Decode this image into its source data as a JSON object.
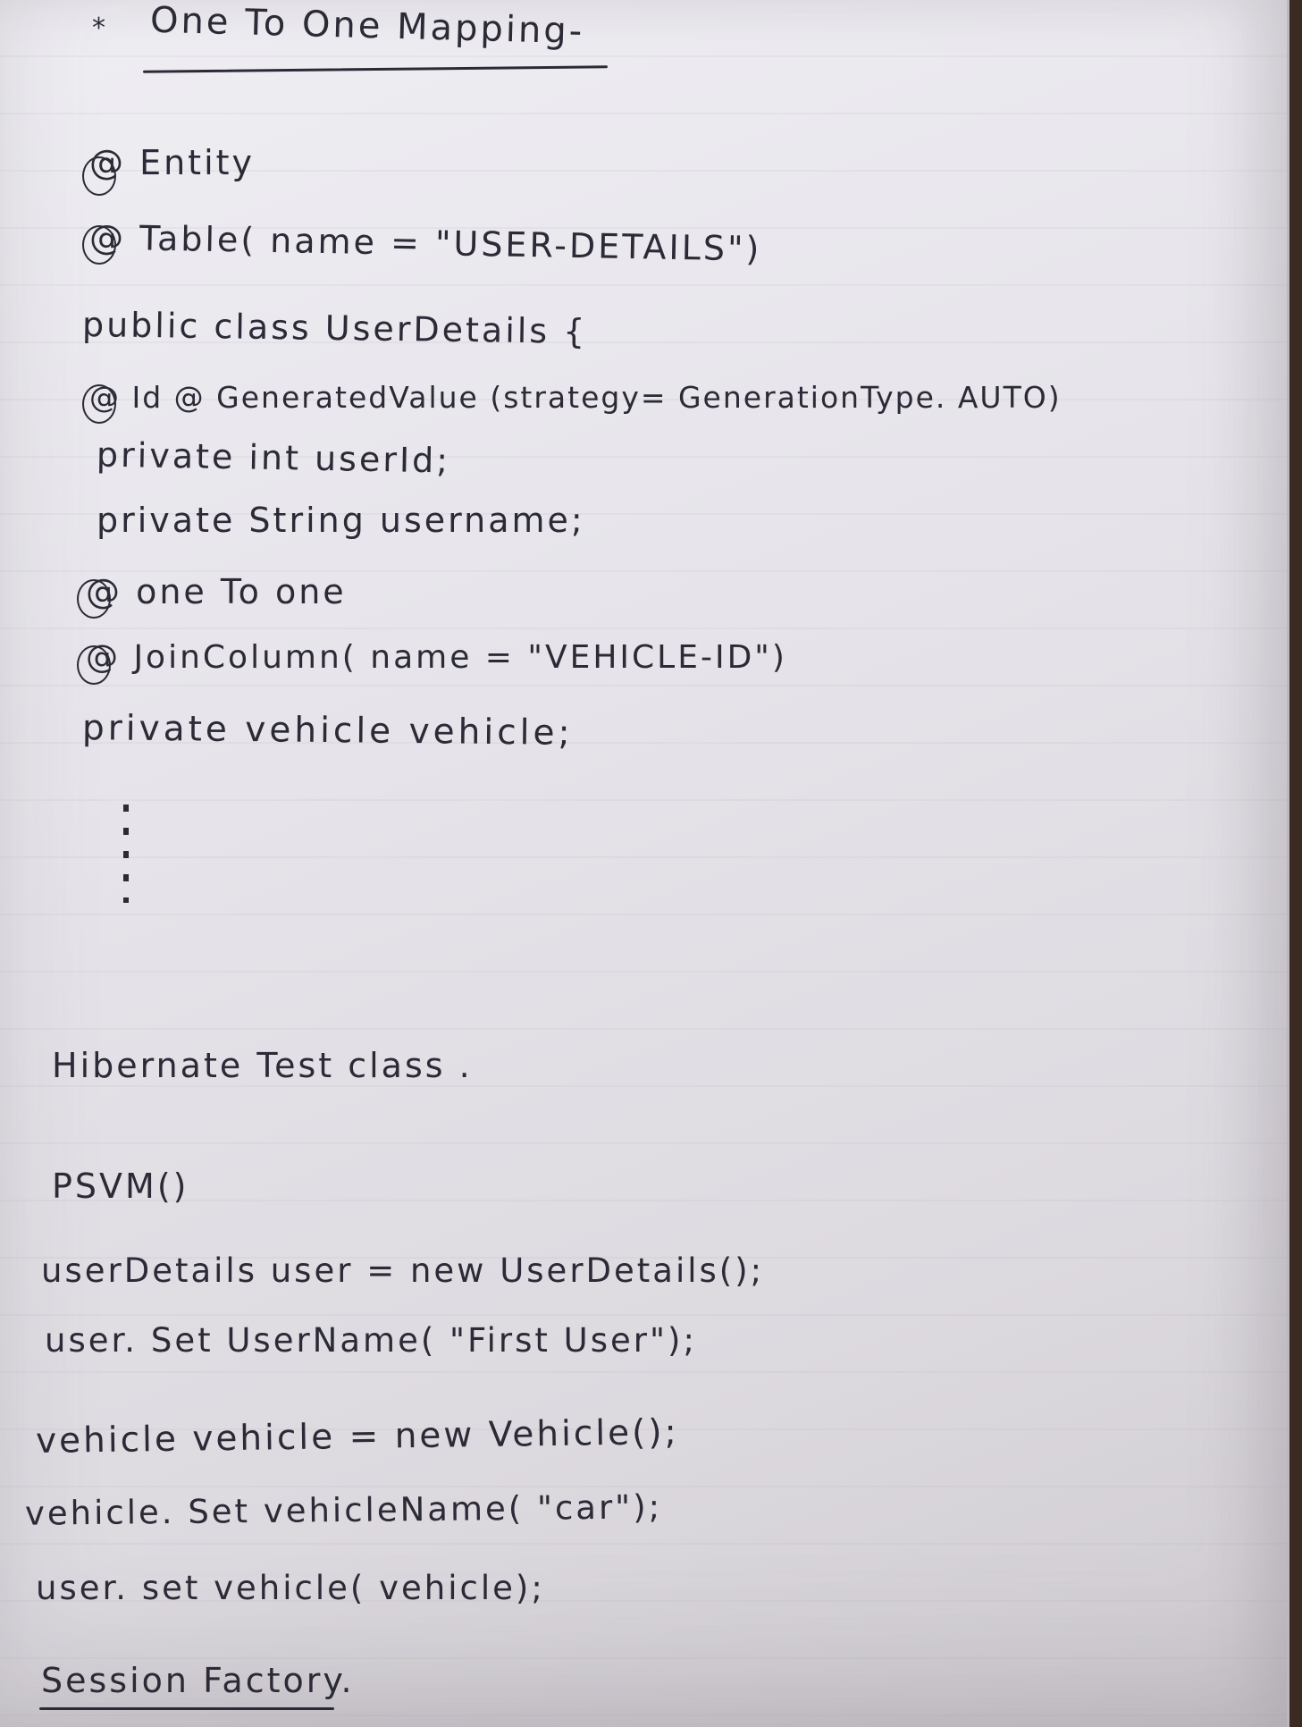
{
  "note": {
    "bullet": "*",
    "heading": "One To One Mapping-",
    "lines": [
      "@ Entity",
      "@ Table( name = \"USER-DETAILS\")",
      "public class UserDetails {",
      "@ Id @ GeneratedValue (strategy= GenerationType. AUTO)",
      "private int userId;",
      "private String username;",
      "@ one To one",
      "@ JoinColumn( name = \"VEHICLE-ID\")",
      "private vehicle vehicle;",
      "Hibernate Test class .",
      "PSVM()",
      "userDetails user = new UserDetails();",
      "user. Set UserName( \"First User\");",
      "vehicle vehicle = new Vehicle();",
      "vehicle. Set vehicleName( \"car\");",
      "user. set vehicle( vehicle);",
      "Session Factory."
    ]
  }
}
